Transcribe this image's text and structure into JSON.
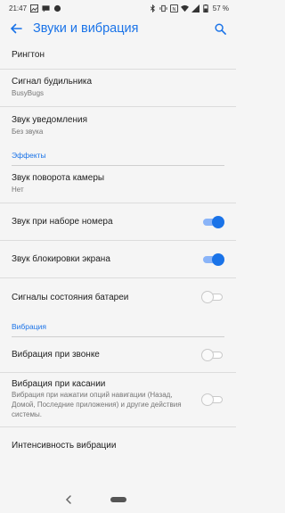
{
  "status": {
    "time": "21:47",
    "battery": "57 %"
  },
  "header": {
    "title": "Звуки и вибрация"
  },
  "items": {
    "ringtone": {
      "title": "Рингтон"
    },
    "alarm": {
      "title": "Сигнал будильника",
      "subtitle": "BusyBugs"
    },
    "notification": {
      "title": "Звук уведомления",
      "subtitle": "Без звука"
    },
    "effects_header": "Эффекты",
    "camera": {
      "title": "Звук поворота камеры",
      "subtitle": "Нет"
    },
    "dial": {
      "title": "Звук при наборе номера",
      "toggle": true
    },
    "lock": {
      "title": "Звук блокировки экрана",
      "toggle": true
    },
    "battery": {
      "title": "Сигналы состояния батареи",
      "toggle": false
    },
    "vibration_header": "Вибрация",
    "vibrate_ring": {
      "title": "Вибрация при звонке",
      "toggle": false
    },
    "vibrate_touch": {
      "title": "Вибрация при касании",
      "subtitle": "Вибрация при нажатии опций навигации (Назад, Домой, Последние приложения) и другие действия системы.",
      "toggle": false
    },
    "intensity": {
      "title": "Интенсивность вибрации"
    }
  },
  "colors": {
    "accent": "#1a73e8",
    "background": "#f5f5f5"
  }
}
